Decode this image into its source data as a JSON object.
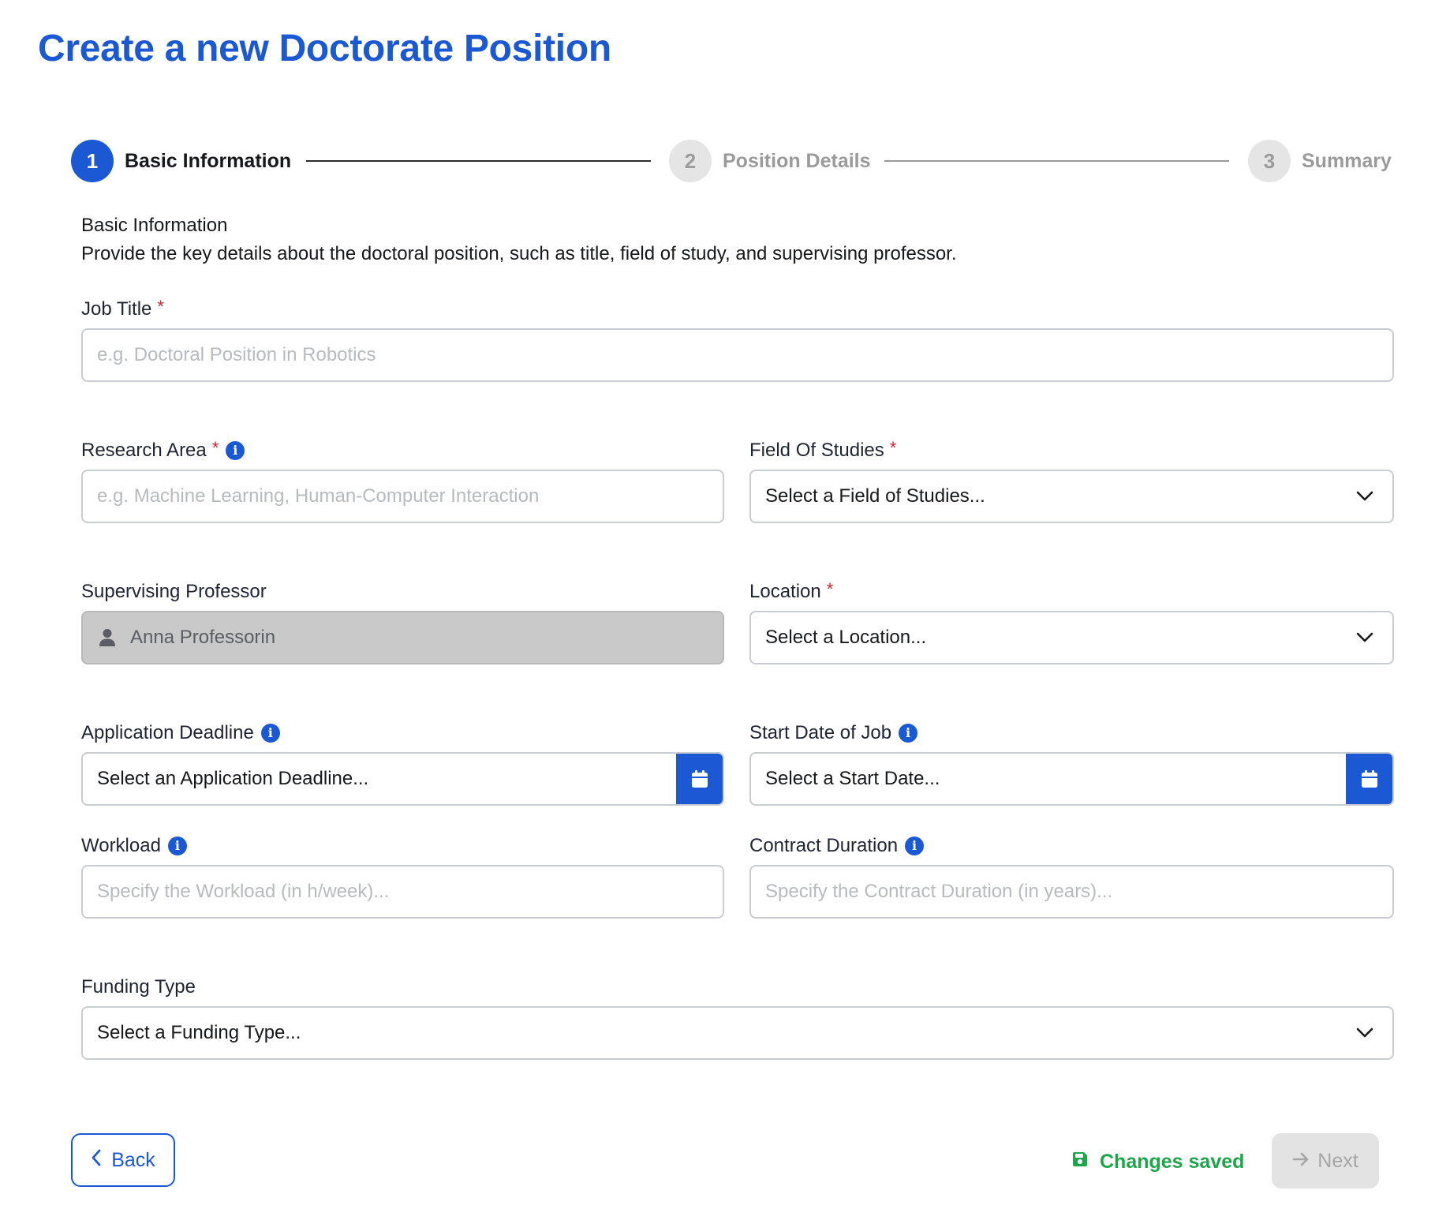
{
  "page": {
    "title": "Create a new Doctorate Position"
  },
  "stepper": {
    "steps": [
      {
        "number": "1",
        "label": "Basic Information",
        "state": "active"
      },
      {
        "number": "2",
        "label": "Position Details",
        "state": "inactive"
      },
      {
        "number": "3",
        "label": "Summary",
        "state": "inactive"
      }
    ]
  },
  "section": {
    "heading": "Basic Information",
    "description": "Provide the key details about the doctoral position, such as title, field of study, and supervising professor."
  },
  "fields": {
    "job_title": {
      "label": "Job Title",
      "required_mark": "*",
      "placeholder": "e.g. Doctoral Position in Robotics",
      "value": ""
    },
    "research_area": {
      "label": "Research Area",
      "required_mark": "*",
      "placeholder": "e.g. Machine Learning, Human-Computer Interaction",
      "value": ""
    },
    "field_of_studies": {
      "label": "Field Of Studies",
      "required_mark": "*",
      "selected": "Select a Field of Studies..."
    },
    "supervising_professor": {
      "label": "Supervising Professor",
      "value": "Anna Professorin"
    },
    "location": {
      "label": "Location",
      "required_mark": "*",
      "selected": "Select a Location..."
    },
    "application_deadline": {
      "label": "Application Deadline",
      "value": "Select an Application Deadline..."
    },
    "start_date": {
      "label": "Start Date of Job",
      "value": "Select a Start Date..."
    },
    "workload": {
      "label": "Workload",
      "placeholder": "Specify the Workload (in h/week)...",
      "value": ""
    },
    "contract_duration": {
      "label": "Contract Duration",
      "placeholder": "Specify the Contract Duration (in years)...",
      "value": ""
    },
    "funding_type": {
      "label": "Funding Type",
      "selected": "Select a Funding Type..."
    }
  },
  "footer": {
    "back_label": "Back",
    "saved_status": "Changes saved",
    "next_label": "Next"
  },
  "icons": {
    "info": "info-icon",
    "chevron": "chevron-down-icon",
    "user": "user-icon",
    "calendar": "calendar-icon",
    "save": "save-icon",
    "back": "chevron-left-icon",
    "next": "arrow-right-icon"
  },
  "colors": {
    "primary": "#1b58d4",
    "required": "#d4202c",
    "success": "#1ea64b",
    "disabled_bg": "#c9c9c9",
    "inactive_step": "#9a9a9a"
  }
}
